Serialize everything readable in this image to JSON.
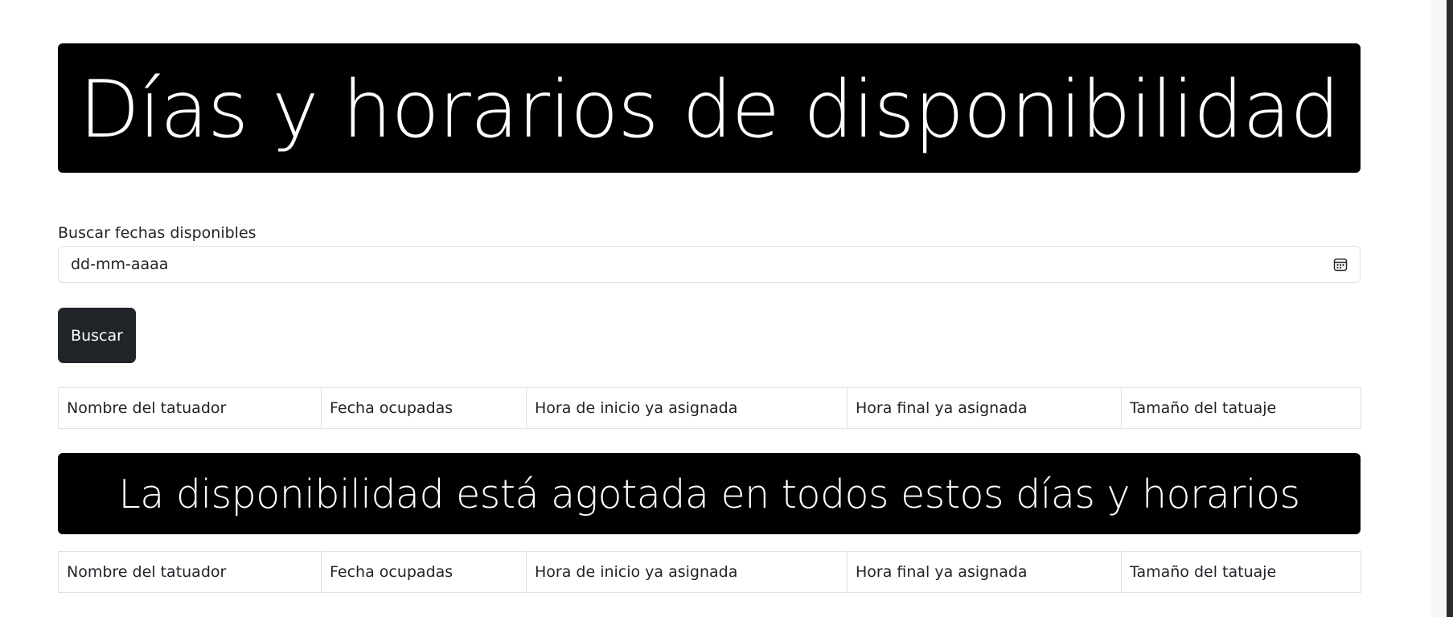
{
  "hero": {
    "title": "Días y horarios de disponibilidad"
  },
  "search": {
    "label": "Buscar fechas disponibles",
    "date_placeholder": "dd-mm-aaaa",
    "calendar_icon": "calendar-icon",
    "button_label": "Buscar"
  },
  "table_available": {
    "headers": [
      "Nombre del tatuador",
      "Fecha ocupadas",
      "Hora de inicio ya asignada",
      "Hora final ya asignada",
      "Tamaño del tatuaje"
    ]
  },
  "banner": {
    "text": "La disponibilidad está agotada en todos estos días y horarios"
  },
  "table_unavailable": {
    "headers": [
      "Nombre del tatuador",
      "Fecha ocupadas",
      "Hora de inicio ya asignada",
      "Hora final ya asignada",
      "Tamaño del tatuaje"
    ]
  },
  "colors": {
    "banner_bg": "#000000",
    "button_bg": "#212529",
    "border": "#dee2e6"
  }
}
